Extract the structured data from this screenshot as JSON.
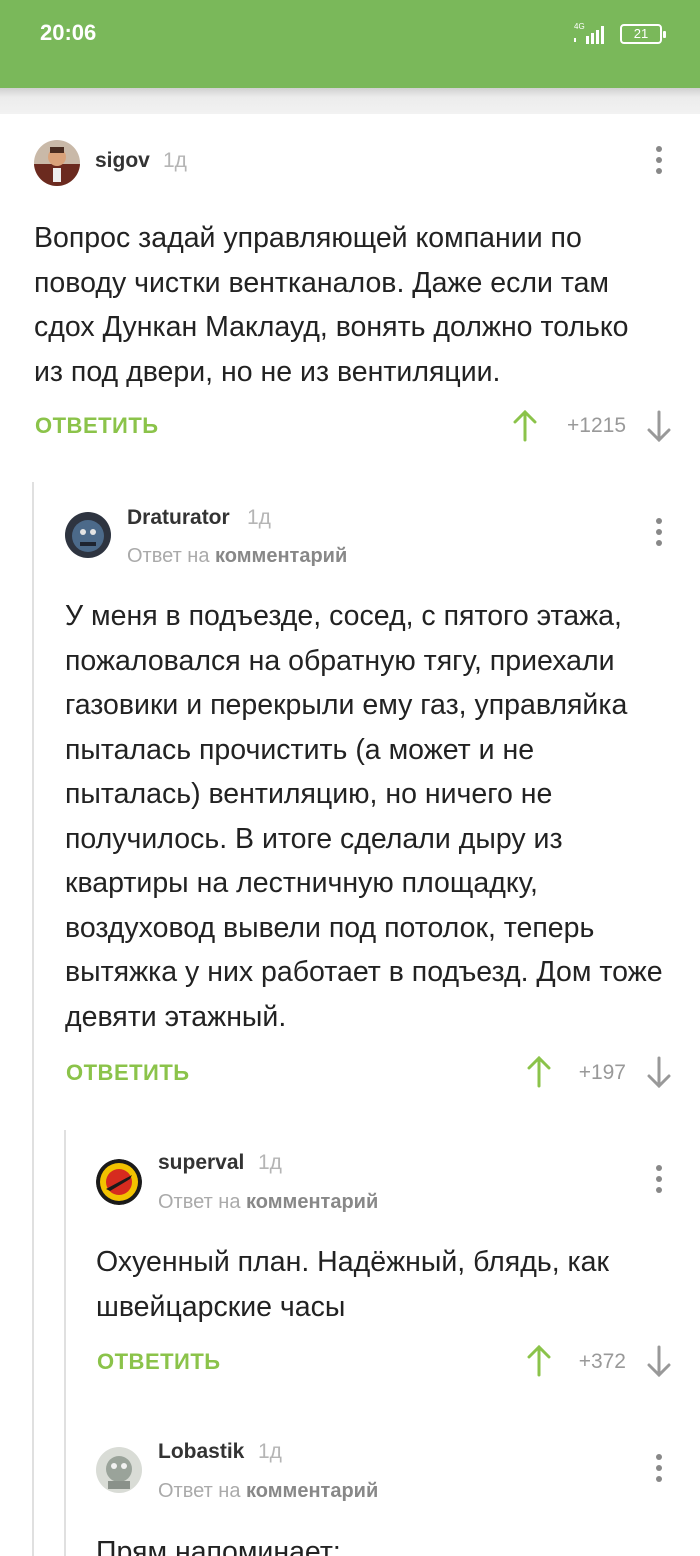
{
  "status": {
    "time": "20:06",
    "network": "4G",
    "battery": "21"
  },
  "comments": [
    {
      "user": "sigov",
      "time": "1д",
      "text": "Вопрос задай управляющей компании по поводу чистки вентканалов. Даже если там сдох Дункан Маклауд, вонять должно только из под двери, но не из вентиляции.",
      "reply_label": "ОТВЕТИТЬ",
      "score": "+1215"
    },
    {
      "user": "Draturator",
      "time": "1д",
      "reply_prefix": "Ответ на",
      "reply_target": "комментарий",
      "text": "У меня в подъезде, сосед, с пятого этажа, пожаловался на обратную тягу, приехали газовики и перекрыли ему газ, управляйка пыталась прочистить (а может и не пыталась) вентиляцию, но ничего не получилось. В итоге сделали дыру из квартиры на лестничную площадку, воздуховод вывели под потолок, теперь вытяжка у них работает в подъезд. Дом тоже девяти этажный.",
      "reply_label": "ОТВЕТИТЬ",
      "score": "+197"
    },
    {
      "user": "superval",
      "time": "1д",
      "reply_prefix": "Ответ на",
      "reply_target": "комментарий",
      "text": "Охуенный план. Надёжный, блядь, как швейцарские часы",
      "reply_label": "ОТВЕТИТЬ",
      "score": "+372"
    },
    {
      "user": "Lobastik",
      "time": "1д",
      "reply_prefix": "Ответ на",
      "reply_target": "комментарий",
      "text": "Прям напоминает:"
    }
  ],
  "icons": {
    "upvote": "arrow-up-icon",
    "downvote": "arrow-down-icon",
    "menu": "more-vertical-icon"
  },
  "colors": {
    "brand": "#7ab85a",
    "accent": "#8bc34a"
  }
}
